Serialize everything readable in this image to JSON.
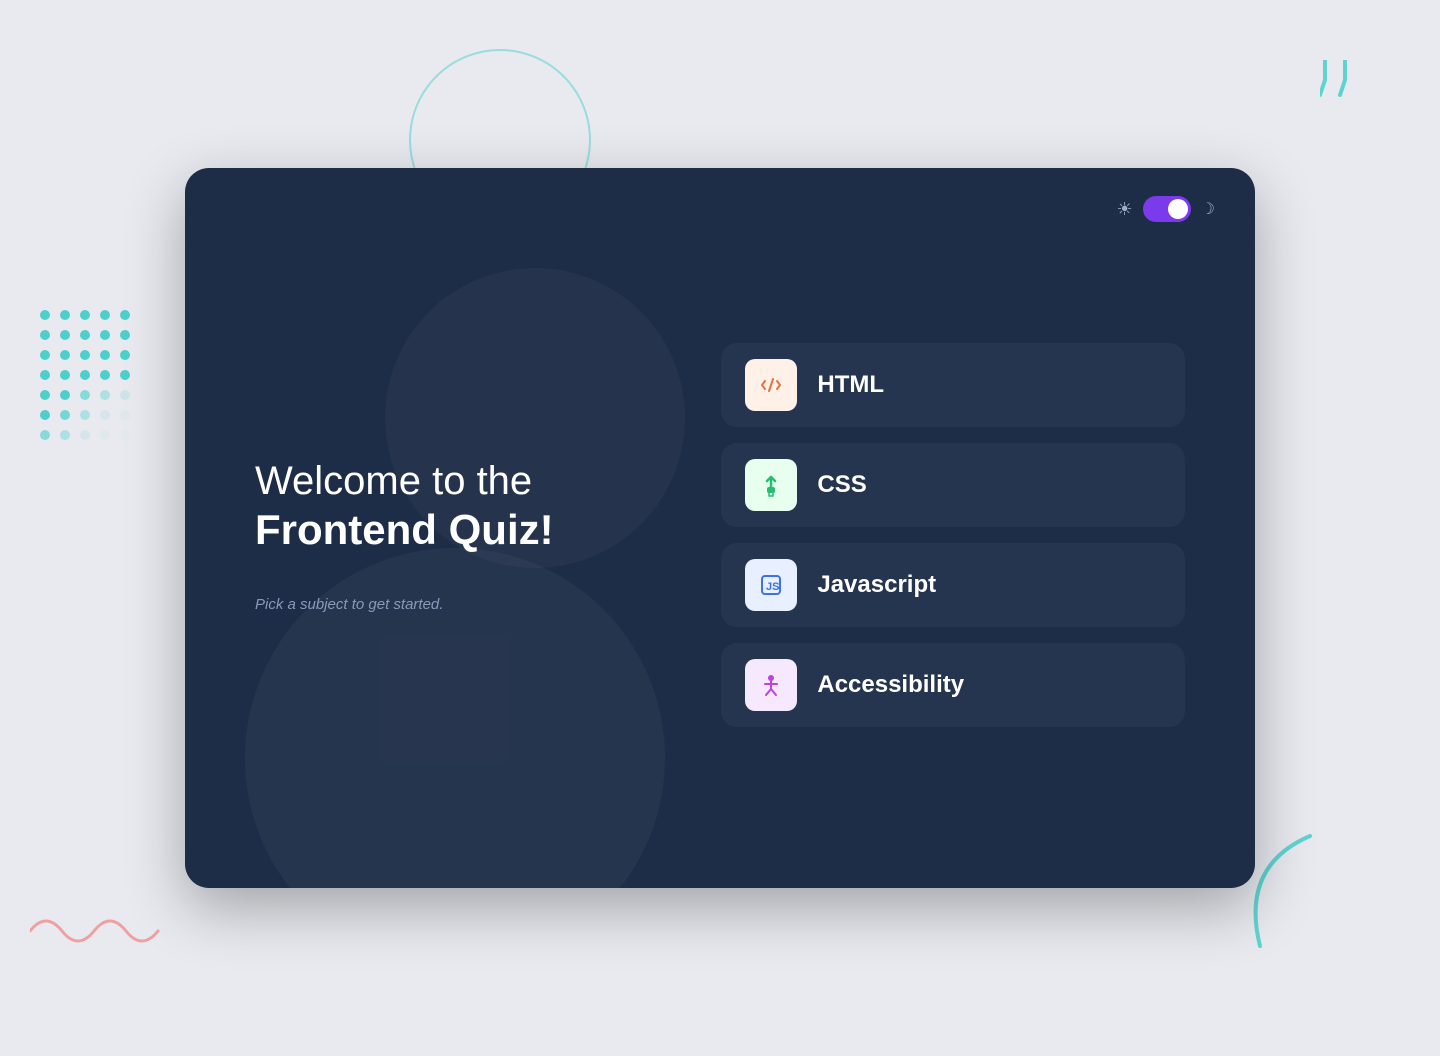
{
  "background": {
    "color": "#e8eaf0"
  },
  "card": {
    "background": "#1e2d47"
  },
  "header": {
    "theme_toggle_state": "dark"
  },
  "left": {
    "welcome_line1": "Welcome to the",
    "welcome_line2": "Frontend Quiz!",
    "subtitle": "Pick a subject to get started."
  },
  "options": [
    {
      "id": "html",
      "label": "HTML",
      "icon_type": "html",
      "icon_color_bg": "#fff0e8"
    },
    {
      "id": "css",
      "label": "CSS",
      "icon_type": "css",
      "icon_color_bg": "#e8fff0"
    },
    {
      "id": "javascript",
      "label": "Javascript",
      "icon_type": "js",
      "icon_color_bg": "#e8f0ff"
    },
    {
      "id": "accessibility",
      "label": "Accessibility",
      "icon_type": "a11y",
      "icon_color_bg": "#f5e8ff"
    }
  ],
  "icons": {
    "sun": "☀",
    "moon": "☽"
  }
}
